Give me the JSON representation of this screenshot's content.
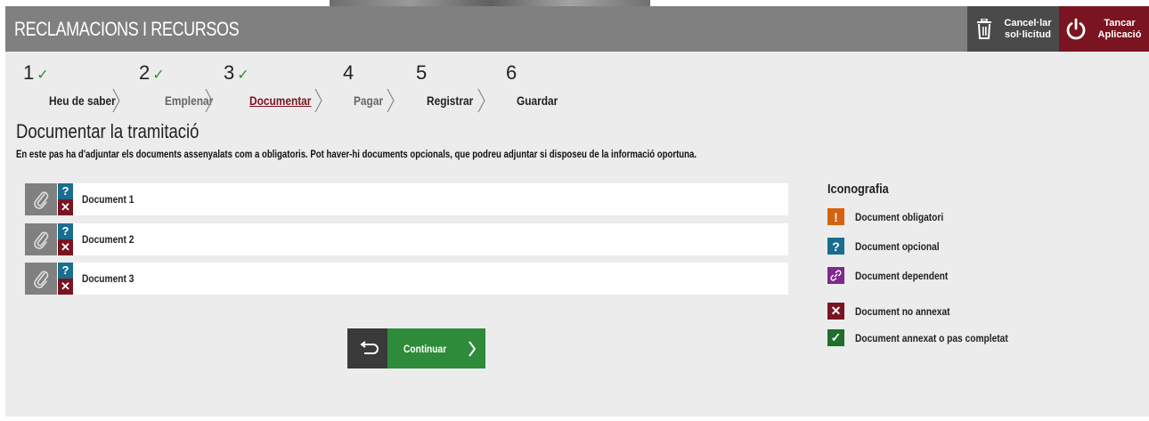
{
  "header": {
    "title": "RECLAMACIONS I RECURSOS",
    "cancel_label_1": "Cancel·lar",
    "cancel_label_2": "sol·licitud",
    "close_label_1": "Tancar",
    "close_label_2": "Aplicació"
  },
  "steps": [
    {
      "number": "1",
      "check": "✓",
      "label": "Heu de saber"
    },
    {
      "number": "2",
      "check": "✓",
      "label": "Emplenar"
    },
    {
      "number": "3",
      "check": "✓",
      "label": "Documentar"
    },
    {
      "number": "4",
      "check": "",
      "label": "Pagar"
    },
    {
      "number": "5",
      "check": "",
      "label": "Registrar"
    },
    {
      "number": "6",
      "check": "",
      "label": "Guardar"
    }
  ],
  "main": {
    "title": "Documentar la tramitació",
    "intro": "En este pas ha d'adjuntar els documents assenyalats com a obligatoris. Pot haver-hi documents opcionals, que podreu adjuntar si disposeu de la informació oportuna."
  },
  "documents": [
    {
      "label": "Document 1",
      "type_badge": "?",
      "status_badge": "✕"
    },
    {
      "label": "Document 2",
      "type_badge": "?",
      "status_badge": "✕"
    },
    {
      "label": "Document 3",
      "type_badge": "?",
      "status_badge": "✕"
    }
  ],
  "legend": {
    "title": "Iconografia",
    "items": [
      {
        "symbol": "!",
        "label": "Document obligatori",
        "color": "#d4620f",
        "icon": "exclamation-icon"
      },
      {
        "symbol": "?",
        "label": "Document opcional",
        "color": "#1a6d8e",
        "icon": "question-icon"
      },
      {
        "symbol": "",
        "label": "Document dependent",
        "color": "#7b2a8e",
        "icon": "link-icon"
      },
      {
        "symbol": "✕",
        "label": "Document no annexat",
        "color": "#7a1420",
        "icon": "cross-icon"
      },
      {
        "symbol": "✓",
        "label": "Document annexat o pas completat",
        "color": "#1f6e2b",
        "icon": "check-icon"
      }
    ]
  },
  "actions": {
    "continue_label": "Continuar"
  },
  "colors": {
    "header_bg": "#808080",
    "cancel_bg": "#4a4a4a",
    "close_bg": "#7a1420",
    "continue_bg": "#2e8b3a",
    "active_step": "#7a1420"
  }
}
